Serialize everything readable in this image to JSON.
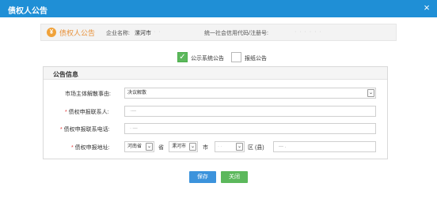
{
  "dialog": {
    "title": "债权人公告",
    "close_symbol": "×"
  },
  "header": {
    "icon_text": "¥",
    "section_title": "债权人公告",
    "company_label": "企业名称:",
    "company_value": "漯河市",
    "company_blurred": "·          ·",
    "credit_label": "统一社会信用代码/注册号:",
    "credit_blurred": "·  ·  ·   ·  ·  ·"
  },
  "checkboxes": [
    {
      "label": "公示系统公告",
      "checked": true
    },
    {
      "label": "报纸公告",
      "checked": false
    }
  ],
  "section": {
    "title": "公告信息"
  },
  "fields": {
    "reason": {
      "label": "市场主体解散事由:",
      "value": "决议解散"
    },
    "contact": {
      "label": "债权申报联系人:",
      "value": "·—"
    },
    "phone": {
      "label": "债权申报联系电话:",
      "value": "· —"
    },
    "address": {
      "label": "债权申报地址:",
      "province": "河南省",
      "province_unit": "省",
      "city": "漯河市",
      "city_unit": "市",
      "county": "· ·",
      "county_unit": "区 (县)",
      "detail": "— ."
    }
  },
  "buttons": {
    "save": "保存",
    "close": "关闭"
  }
}
